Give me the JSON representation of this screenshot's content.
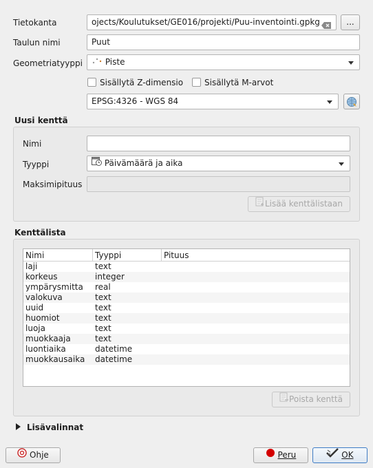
{
  "form": {
    "database_label": "Tietokanta",
    "database_value": "ojects/Koulutukset/GE016/projekti/Puu-inventointi.gpkg",
    "browse_label": "...",
    "table_name_label": "Taulun nimi",
    "table_name_value": "Puut",
    "geometry_type_label": "Geometriatyyppi",
    "geometry_type_value": "Piste",
    "include_z_label": "Sisällytä Z-dimensio",
    "include_m_label": "Sisällytä M-arvot",
    "crs_value": "EPSG:4326 - WGS 84"
  },
  "new_field": {
    "title": "Uusi kenttä",
    "name_label": "Nimi",
    "name_value": "",
    "type_label": "Tyyppi",
    "type_value": "Päivämäärä ja aika",
    "max_length_label": "Maksimipituus",
    "max_length_value": "",
    "add_button_label": "Lisää kenttälistaan"
  },
  "field_list": {
    "title": "Kenttälista",
    "columns": [
      "Nimi",
      "Tyyppi",
      "Pituus"
    ],
    "rows": [
      [
        "laji",
        "text",
        ""
      ],
      [
        "korkeus",
        "integer",
        ""
      ],
      [
        "ympärysmitta",
        "real",
        ""
      ],
      [
        "valokuva",
        "text",
        ""
      ],
      [
        "uuid",
        "text",
        ""
      ],
      [
        "huomiot",
        "text",
        ""
      ],
      [
        "luoja",
        "text",
        ""
      ],
      [
        "muokkaaja",
        "text",
        ""
      ],
      [
        "luontiaika",
        "datetime",
        ""
      ],
      [
        "muokkausaika",
        "datetime",
        ""
      ]
    ],
    "remove_button_label": "Poista kenttä"
  },
  "advanced": {
    "label": "Lisävalinnat"
  },
  "footer": {
    "help_label": "Ohje",
    "cancel_label": "Peru",
    "ok_label": "OK"
  },
  "icons": {
    "clear": "clear-text-icon",
    "point": "point-geometry-icon",
    "crs": "crs-selector-icon",
    "datetime": "calendar-clock-icon",
    "add": "add-field-icon",
    "remove": "remove-field-icon",
    "help": "help-icon",
    "cancel": "cancel-icon",
    "ok": "ok-check-icon",
    "expand": "expand-arrow-icon"
  }
}
